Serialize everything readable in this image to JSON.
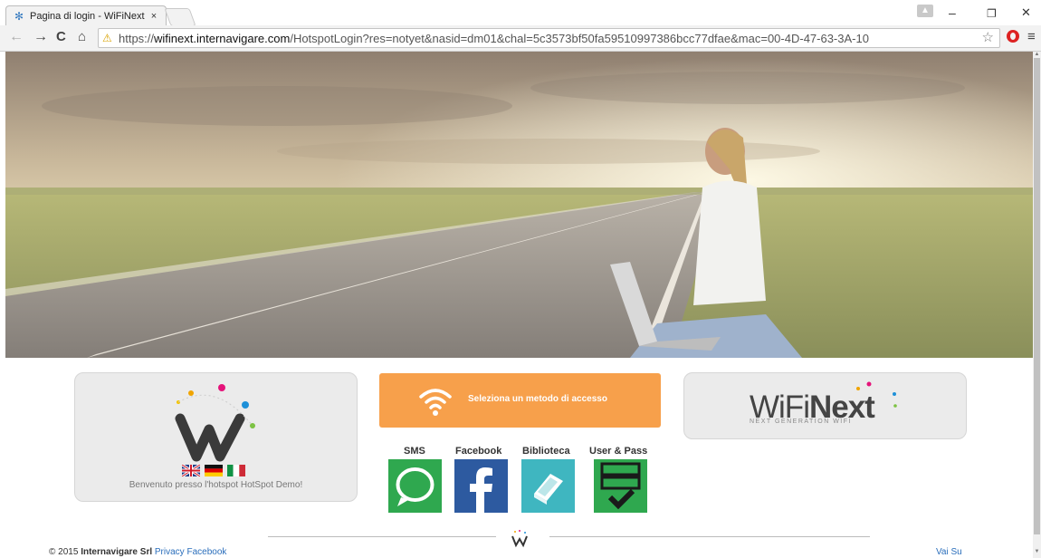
{
  "browser": {
    "tab_title": "Pagina di login - WiFiNext",
    "tab_close": "×",
    "url_scheme": "https://",
    "url_host": "wifinext.internavigare.com",
    "url_path": "/HotspotLogin?res=notyet&nasid=dm01&chal=5c3573bf50fa59510997386bcc77dfae&mac=00-4D-47-63-3A-10",
    "back_icon": "←",
    "forward_icon": "→",
    "reload_icon": "C",
    "home_icon": "⌂",
    "star_icon": "☆",
    "menu_icon": "≡",
    "minimize": "–",
    "restore": "❐",
    "close": "✕"
  },
  "welcome": {
    "text": "Benvenuto presso l'hotspot HotSpot Demo!",
    "flags": [
      "uk-flag",
      "german-flag",
      "italian-flag"
    ]
  },
  "access": {
    "label": "Seleziona un metodo di accesso"
  },
  "brand": {
    "wifi": "WiFi",
    "next": "Next",
    "tagline": "NEXT GENERATION WIFI"
  },
  "methods": [
    {
      "label": "SMS",
      "color": "#2fa84f"
    },
    {
      "label": "Facebook",
      "color": "#2d5aa0"
    },
    {
      "label": "Biblioteca",
      "color": "#3fb6c0"
    },
    {
      "label": "User & Pass",
      "color": "#2fa84f"
    }
  ],
  "footer": {
    "copyright": "© 2015",
    "company": "Internavigare Srl",
    "privacy": "Privacy",
    "facebook": "Facebook",
    "top_link": "Vai Su"
  }
}
